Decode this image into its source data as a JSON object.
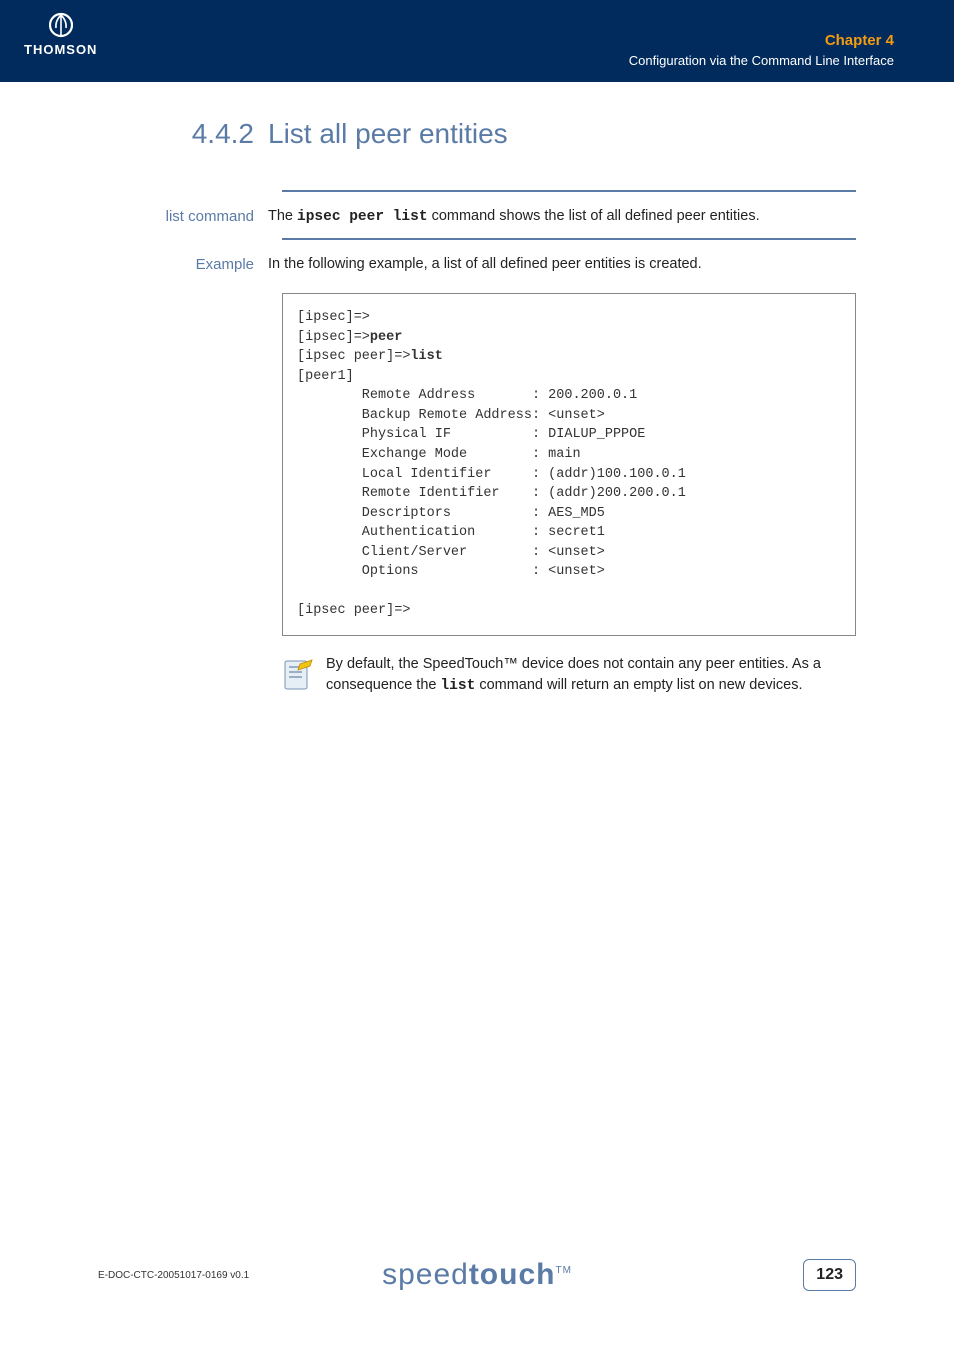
{
  "header": {
    "logo_text": "THOMSON",
    "chapter_label": "Chapter 4",
    "chapter_subtitle": "Configuration via the Command Line Interface"
  },
  "section": {
    "number": "4.4.2",
    "title": "List all peer entities"
  },
  "list_command": {
    "label": "list command",
    "text_before": "The ",
    "cmd": "ipsec peer list",
    "text_after": " command shows the list of all defined peer entities."
  },
  "example": {
    "label": "Example",
    "intro": "In the following example, a list of all defined peer entities is created.",
    "code": {
      "l1": "[ipsec]=>",
      "l2a": "[ipsec]=>",
      "l2b": "peer",
      "l3a": "[ipsec peer]=>",
      "l3b": "list",
      "l4": "[peer1]",
      "l5": "        Remote Address       : 200.200.0.1",
      "l6": "        Backup Remote Address: <unset>",
      "l7": "        Physical IF          : DIALUP_PPPOE",
      "l8": "        Exchange Mode        : main",
      "l9": "        Local Identifier     : (addr)100.100.0.1",
      "l10": "        Remote Identifier    : (addr)200.200.0.1",
      "l11": "        Descriptors          : AES_MD5",
      "l12": "        Authentication       : secret1",
      "l13": "        Client/Server        : <unset>",
      "l14": "        Options              : <unset>",
      "l15": "",
      "l16": "[ipsec peer]=>"
    }
  },
  "note": {
    "text_before": "By default, the SpeedTouch™ device does not contain any peer entities. As a consequence the ",
    "cmd": "list",
    "text_after": " command will return an empty list on new devices."
  },
  "footer": {
    "docref": "E-DOC-CTC-20051017-0169 v0.1",
    "brand_light": "speed",
    "brand_bold": "touch",
    "brand_tm": "TM",
    "page": "123"
  }
}
